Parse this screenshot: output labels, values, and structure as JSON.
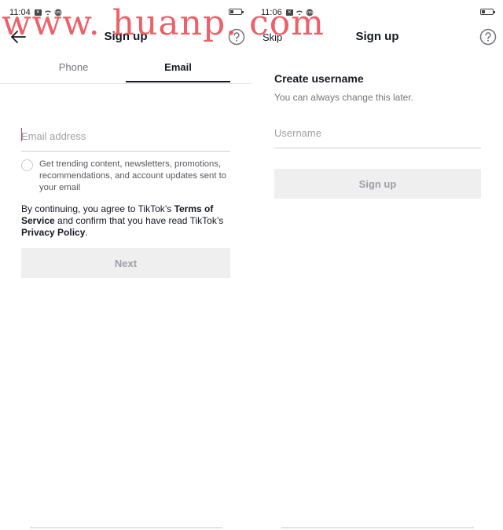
{
  "left": {
    "status": {
      "time": "11:04"
    },
    "header": {
      "title": "Sign up"
    },
    "tabs": [
      {
        "label": "Phone",
        "active": false
      },
      {
        "label": "Email",
        "active": true
      }
    ],
    "email_input": {
      "placeholder": "Email address",
      "value": ""
    },
    "optin": {
      "checked": false,
      "text": "Get trending content, newsletters, promotions, recommendations, and account updates sent to your email"
    },
    "terms": {
      "prefix": "By continuing, you agree to TikTok’s ",
      "terms_link": "Terms of Service",
      "middle": " and confirm that you have read TikTok’s ",
      "privacy_link": "Privacy Policy",
      "suffix": "."
    },
    "next_button": "Next"
  },
  "right": {
    "status": {
      "time": "11:06"
    },
    "header": {
      "title": "Sign up",
      "skip_label": "Skip"
    },
    "heading": "Create username",
    "subheading": "You can always change this later.",
    "username_input": {
      "placeholder": "Username",
      "value": ""
    },
    "signup_button": "Sign up"
  },
  "watermark": "www. huanp. com",
  "icons": {
    "back": "arrow-left-icon",
    "help": "question-circle-icon",
    "battery": "battery-icon",
    "wifi": "wifi-icon"
  },
  "colors": {
    "primary_text": "#161823",
    "secondary_text": "#75767c",
    "disabled_button_bg": "#efeff0",
    "disabled_button_text": "#9fa0a5",
    "caret": "#fe2c55",
    "watermark": "#ee4e58"
  }
}
